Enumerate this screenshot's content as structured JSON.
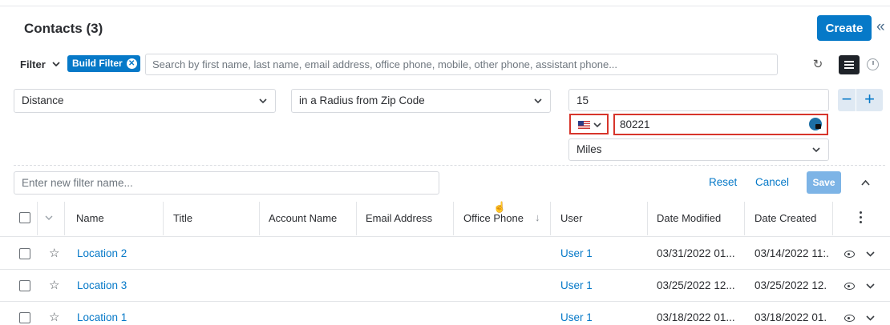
{
  "header": {
    "title": "Contacts (3)",
    "create_label": "Create",
    "collapse_glyph": "«"
  },
  "filter_bar": {
    "filter_label": "Filter",
    "build_filter_label": "Build Filter",
    "search_placeholder": "Search by first name, last name, email address, office phone, mobile, other phone, assistant phone..."
  },
  "filter_row": {
    "field": "Distance",
    "operator": "in a Radius from Zip Code",
    "radius_value": "15",
    "country_icon": "us-flag-icon",
    "zip_value": "80221",
    "unit": "Miles"
  },
  "filter_actions": {
    "name_placeholder": "Enter new filter name...",
    "reset_label": "Reset",
    "cancel_label": "Cancel",
    "save_label": "Save"
  },
  "table": {
    "columns": [
      "Name",
      "Title",
      "Account Name",
      "Email Address",
      "Office Phone",
      "User",
      "Date Modified",
      "Date Created"
    ],
    "rows": [
      {
        "name": "Location 2",
        "title": "",
        "account": "",
        "email": "",
        "phone": "",
        "user": "User 1",
        "modified": "03/31/2022 01...",
        "created": "03/14/2022 11:."
      },
      {
        "name": "Location 3",
        "title": "",
        "account": "",
        "email": "",
        "phone": "",
        "user": "User 1",
        "modified": "03/25/2022 12...",
        "created": "03/25/2022 12."
      },
      {
        "name": "Location 1",
        "title": "",
        "account": "",
        "email": "",
        "phone": "",
        "user": "User 1",
        "modified": "03/18/2022 01...",
        "created": "03/18/2022 01."
      }
    ]
  },
  "colors": {
    "accent": "#0679c8",
    "highlight_border": "#d7352b",
    "save_disabled": "#7db4e6"
  }
}
